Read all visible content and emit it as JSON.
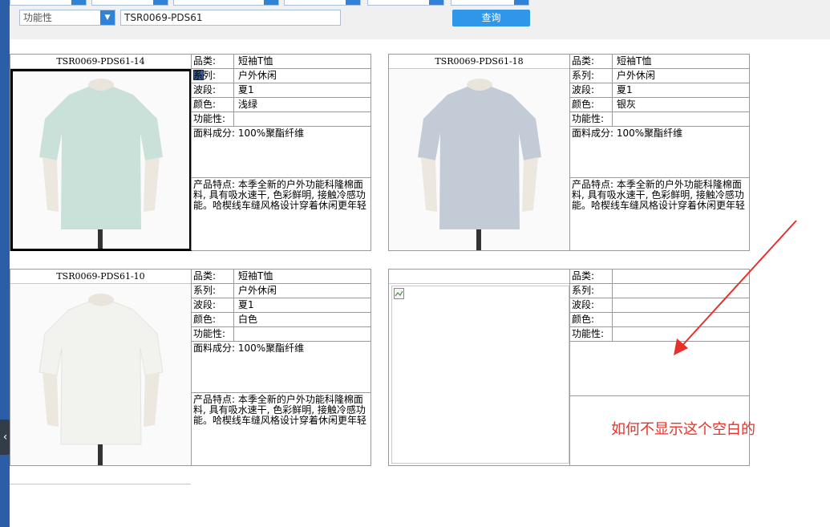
{
  "filters": {
    "functionality_label": "功能性",
    "search_value": "TSR0069-PDS61",
    "query_button": "查询"
  },
  "labels": {
    "category": "品类:",
    "series": "系列:",
    "wave": "波段:",
    "color": "颜色:",
    "functionality": "功能性:"
  },
  "products": [
    {
      "code": "TSR0069-PDS61-14",
      "category": "短袖T恤",
      "series": "户外休闲",
      "wave": "夏1",
      "color": "浅绿",
      "functionality": "",
      "fabric": "面料成分: 100%聚酯纤维",
      "feature": "产品特点: 本季全新的户外功能科隆棉面料, 具有吸水速干, 色彩鲜明, 接触冷感功能。哈楔线车缝风格设计穿着休闲更年轻",
      "shirt_color": "#c9e1d9"
    },
    {
      "code": "TSR0069-PDS61-18",
      "category": "短袖T恤",
      "series": "户外休闲",
      "wave": "夏1",
      "color": "银灰",
      "functionality": "",
      "fabric": "面料成分: 100%聚酯纤维",
      "feature": "产品特点: 本季全新的户外功能科隆棉面料, 具有吸水速干, 色彩鲜明, 接触冷感功能。哈楔线车缝风格设计穿着休闲更年轻",
      "shirt_color": "#c3ccd6"
    },
    {
      "code": "TSR0069-PDS61-10",
      "category": "短袖T恤",
      "series": "户外休闲",
      "wave": "夏1",
      "color": "白色",
      "functionality": "",
      "fabric": "面料成分: 100%聚酯纤维",
      "feature": "产品特点: 本季全新的户外功能科隆棉面料, 具有吸水速干, 色彩鲜明, 接触冷感功能。哈楔线车缝风格设计穿着休闲更年轻",
      "shirt_color": "#f2f2ee"
    }
  ],
  "annotation": "如何不显示这个空白的"
}
